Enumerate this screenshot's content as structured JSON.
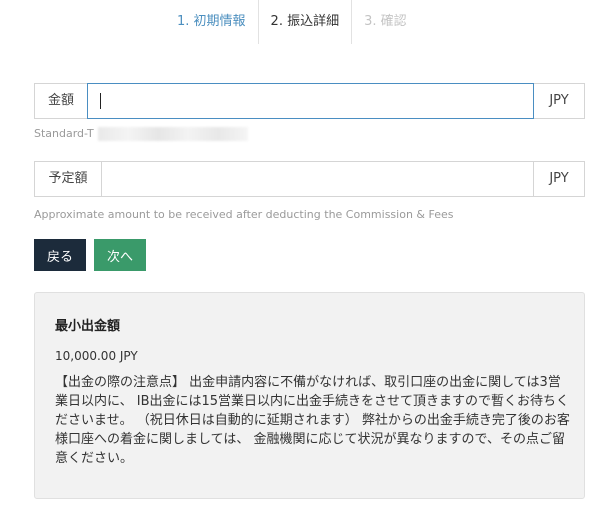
{
  "steps": [
    {
      "label": "1. 初期情報",
      "state": "done"
    },
    {
      "label": "2. 振込詳細",
      "state": "active"
    },
    {
      "label": "3. 確認",
      "state": "pending"
    }
  ],
  "amount_field": {
    "label": "金額",
    "value": "",
    "currency": "JPY"
  },
  "account_line": {
    "text": "Standard-T"
  },
  "expected_field": {
    "label": "予定額",
    "value": "",
    "currency": "JPY"
  },
  "expected_helper": "Approximate amount to be received after deducting the Commission & Fees",
  "buttons": {
    "back": "戻る",
    "next": "次へ"
  },
  "info_panel": {
    "title": "最小出金額",
    "min_amount": "10,000.00 JPY",
    "note": "【出金の際の注意点】 出金申請内容に不備がなければ、取引口座の出金に関しては3営業日以内に、 IB出金には15営業日以内に出金手続きをさせて頂きますので暫くお待ちくださいませ。 （祝日休日は自動的に延期されます） 弊社からの出金手続き完了後のお客様口座への着金に関しましては、 金融機関に応じて状況が異なりますので、その点ご留意ください。"
  },
  "colors": {
    "step_done": "#4c8fbf",
    "step_pending": "#c4c4c4",
    "focus_border": "#4a8ec2",
    "back_button": "#1c2b3b",
    "next_button": "#3a9a6a",
    "panel_bg": "#f2f2f2"
  }
}
